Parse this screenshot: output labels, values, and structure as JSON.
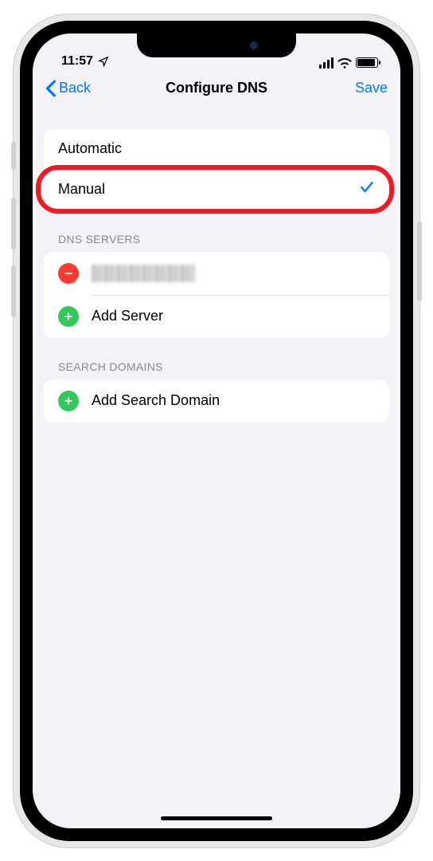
{
  "status": {
    "time": "11:57"
  },
  "nav": {
    "back_label": "Back",
    "title": "Configure DNS",
    "save_label": "Save"
  },
  "dns_mode": {
    "options": [
      {
        "label": "Automatic",
        "selected": false
      },
      {
        "label": "Manual",
        "selected": true,
        "highlighted": true
      }
    ]
  },
  "sections": {
    "dns_servers": {
      "header": "DNS SERVERS",
      "add_label": "Add Server"
    },
    "search_domains": {
      "header": "SEARCH DOMAINS",
      "add_label": "Add Search Domain"
    }
  },
  "colors": {
    "tint": "#007aff",
    "remove": "#ff3b30",
    "add": "#34c759",
    "highlight": "#ed1c24",
    "bg": "#f2f2f7"
  }
}
